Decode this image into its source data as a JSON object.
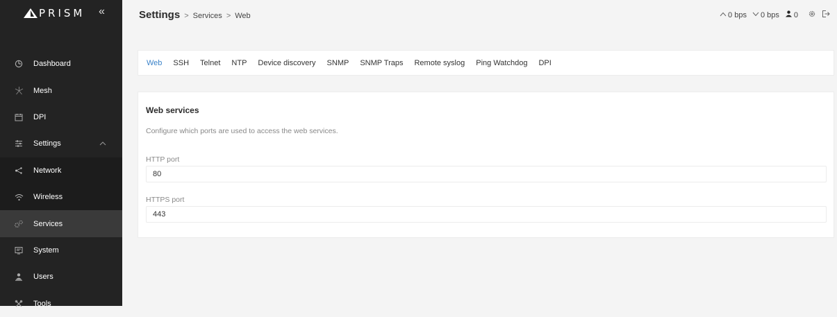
{
  "brand": {
    "name": "PRISM"
  },
  "sidebar": {
    "items": [
      {
        "label": "Dashboard",
        "icon": "dashboard-icon"
      },
      {
        "label": "Mesh",
        "icon": "mesh-icon"
      },
      {
        "label": "DPI",
        "icon": "calendar-icon"
      },
      {
        "label": "Settings",
        "icon": "settings-sliders-icon"
      },
      {
        "label": "Network",
        "icon": "network-share-icon"
      },
      {
        "label": "Wireless",
        "icon": "wifi-icon"
      },
      {
        "label": "Services",
        "icon": "services-gears-icon"
      },
      {
        "label": "System",
        "icon": "system-icon"
      },
      {
        "label": "Users",
        "icon": "users-icon"
      },
      {
        "label": "Tools",
        "icon": "tools-icon"
      }
    ]
  },
  "breadcrumb": {
    "title": "Settings",
    "items": [
      "Services",
      "Web"
    ]
  },
  "status": {
    "upload": "0 bps",
    "download": "0 bps",
    "users": "0"
  },
  "tabs": [
    "Web",
    "SSH",
    "Telnet",
    "NTP",
    "Device discovery",
    "SNMP",
    "SNMP Traps",
    "Remote syslog",
    "Ping Watchdog",
    "DPI"
  ],
  "web_services": {
    "title": "Web services",
    "description": "Configure which ports are used to access the web services.",
    "http_label": "HTTP port",
    "http_value": "80",
    "https_label": "HTTPS port",
    "https_value": "443"
  },
  "colors": {
    "sidebar_bg": "#232323",
    "active_item_bg": "#3a3a3a",
    "accent": "#3b83c9",
    "page_bg": "#f4f4f4"
  }
}
